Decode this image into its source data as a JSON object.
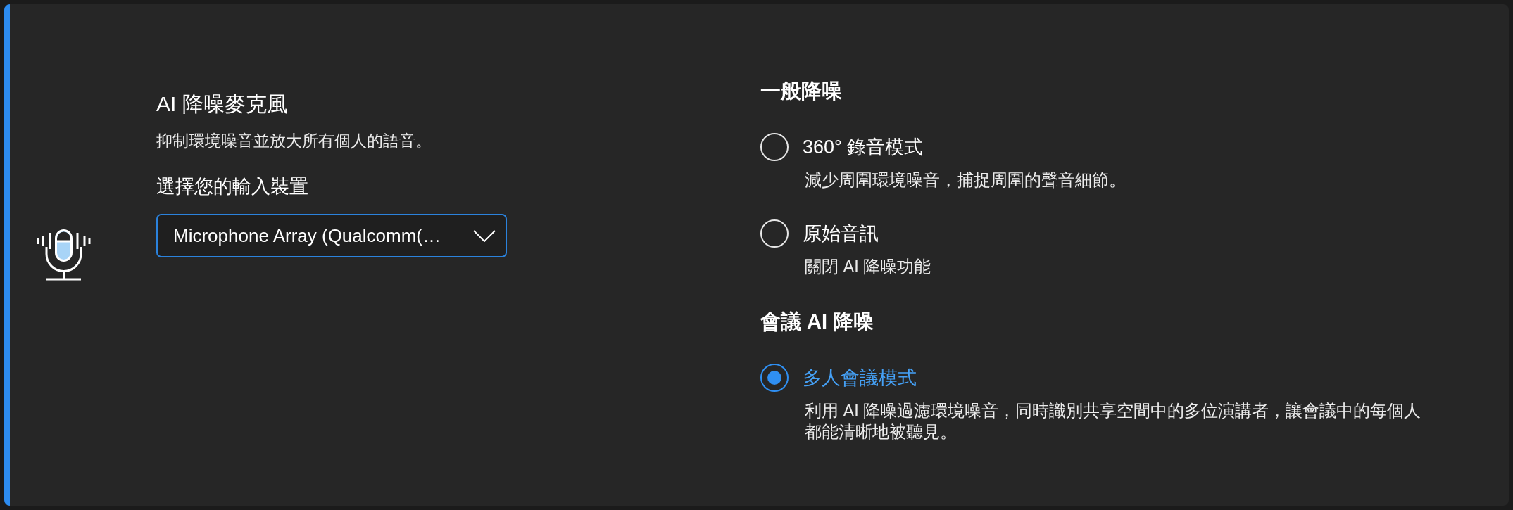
{
  "card": {
    "title": "AI 降噪麥克風",
    "description": "抑制環境噪音並放大所有個人的語音。",
    "device_label": "選擇您的輸入裝置",
    "device_dropdown": {
      "value": "Microphone Array (Qualcomm(…"
    }
  },
  "sections": [
    {
      "heading": "一般降噪",
      "options": [
        {
          "label": "360° 錄音模式",
          "description": "減少周圍環境噪音，捕捉周圍的聲音細節。",
          "selected": false
        },
        {
          "label": "原始音訊",
          "description": "關閉 AI 降噪功能",
          "selected": false
        }
      ]
    },
    {
      "heading": "會議 AI 降噪",
      "options": [
        {
          "label": "多人會議模式",
          "description": "利用 AI 降噪過濾環境噪音，同時識別共享空間中的多位演講者，讓會議中的每個人都能清晰地被聽見。",
          "selected": true
        }
      ]
    }
  ]
}
